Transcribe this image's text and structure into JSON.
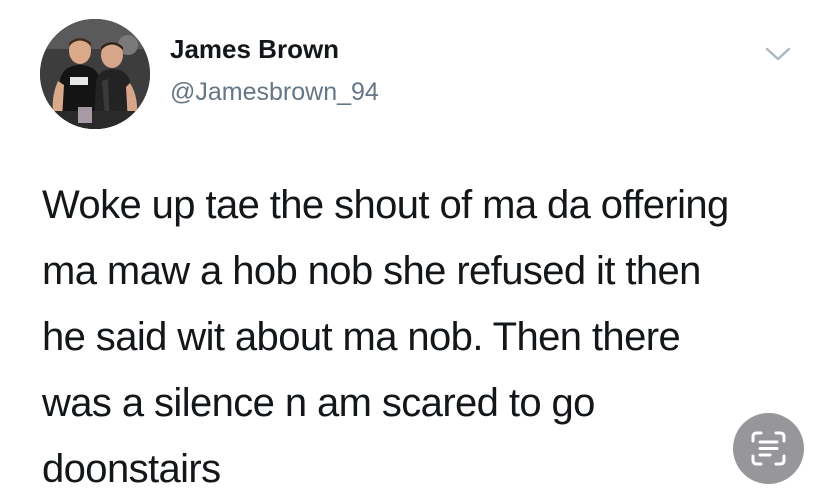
{
  "author": {
    "name": "James Brown",
    "handle": "@Jamesbrown_94"
  },
  "tweet": {
    "lines": [
      "Woke up tae the shout of ma da offering",
      "ma maw a hob nob she refused it then",
      "he said wit about ma nob. Then there",
      "was a silence n am scared to go",
      "doonstairs"
    ]
  },
  "icons": {
    "menu": "chevron-down-icon",
    "overlay": "live-text-scan-icon"
  },
  "colors": {
    "text": "#14171a",
    "handle": "#657786",
    "chevron": "#aab8c2",
    "overlay_button": "#8e8e93"
  }
}
